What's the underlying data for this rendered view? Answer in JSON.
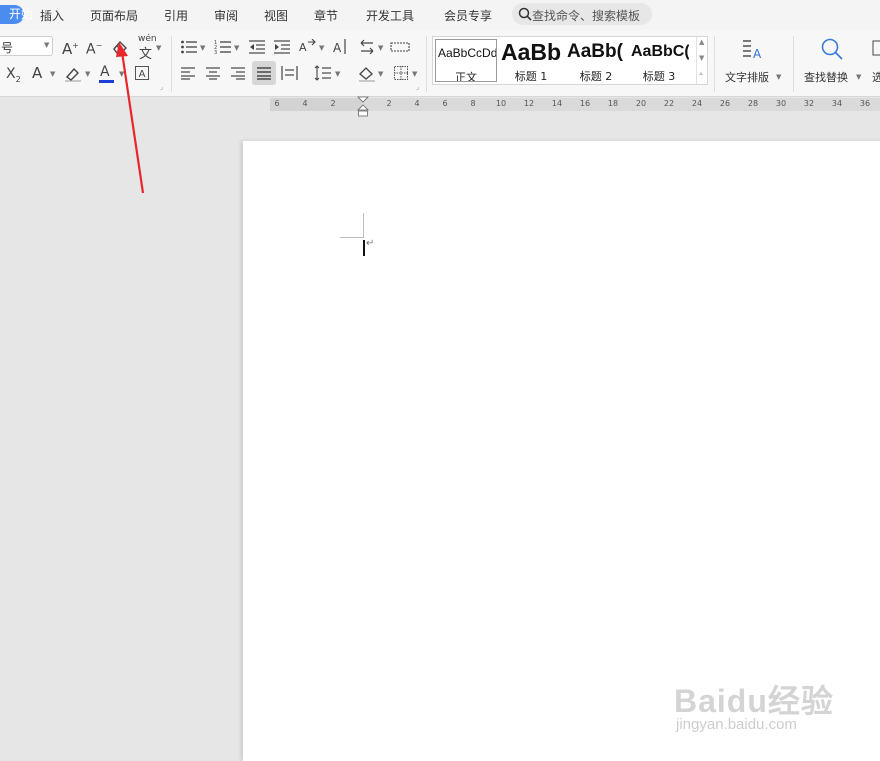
{
  "tabs": {
    "active": "开始",
    "items": [
      "插入",
      "页面布局",
      "引用",
      "审阅",
      "视图",
      "章节",
      "开发工具",
      "会员专享"
    ]
  },
  "search": {
    "placeholder": "查找命令、搜索模板"
  },
  "ribbon": {
    "font_size_value": "号",
    "phonetic_label": "wén",
    "phonetic_char": "文",
    "styles": [
      {
        "preview": "AaBbCcDd",
        "name": "正文"
      },
      {
        "preview": "AaBb",
        "name": "标题 1"
      },
      {
        "preview": "AaBb(",
        "name": "标题 2"
      },
      {
        "preview": "AaBbC(",
        "name": "标题 3"
      }
    ],
    "text_layout_label": "文字排版",
    "find_replace_label": "查找替换",
    "select_label": "选"
  },
  "ruler": {
    "ticks": [
      "6",
      "4",
      "2",
      "2",
      "4",
      "6",
      "8",
      "10",
      "12",
      "14",
      "16",
      "18",
      "20",
      "22",
      "24",
      "26",
      "28",
      "30",
      "32",
      "34",
      "36"
    ]
  },
  "colors": {
    "accent": "#4a8cf0",
    "font_color_bar": "#1a3dd6",
    "arrow": "#e8262b"
  },
  "watermark": {
    "brand": "Baidu经验",
    "url": "jingyan.baidu.com"
  }
}
